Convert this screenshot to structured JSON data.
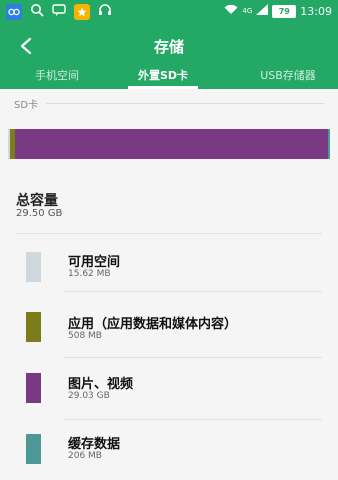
{
  "status_bar": {
    "network_label": "4G",
    "battery": "79",
    "time": "13:09",
    "icons": [
      "app-icon-blue",
      "search-icon",
      "message-icon",
      "app-icon-yellow",
      "headset-icon",
      "wifi-icon",
      "signal-icon"
    ]
  },
  "header": {
    "title": "存储",
    "back_icon": "back-arrow-icon"
  },
  "tabs": [
    {
      "label": "手机空间",
      "active": false
    },
    {
      "label": "外置SD卡",
      "active": true
    },
    {
      "label": "USB存储器",
      "active": false
    }
  ],
  "section_label": "SD卡",
  "usage_bar": {
    "segments": [
      {
        "name": "可用空间",
        "fraction": 0.53,
        "color": "#cfd8dc"
      },
      {
        "name": "应用",
        "fraction": 1.72,
        "color": "#7b7d1b"
      },
      {
        "name": "图片、视频",
        "fraction": 98.4,
        "color": "#7a3a83"
      },
      {
        "name": "缓存数据",
        "fraction": 0.7,
        "color": "#4e9898"
      }
    ]
  },
  "total": {
    "title": "总容量",
    "size": "29.50 GB"
  },
  "items": [
    {
      "name": "可用空间",
      "size": "15.62 MB",
      "color": "#cfd8dc"
    },
    {
      "name": "应用（应用数据和媒体内容）",
      "size": "508 MB",
      "color": "#7b7d1b"
    },
    {
      "name": "图片、视频",
      "size": "29.03 GB",
      "color": "#7a3a83"
    },
    {
      "name": "缓存数据",
      "size": "206 MB",
      "color": "#4e9898"
    }
  ]
}
